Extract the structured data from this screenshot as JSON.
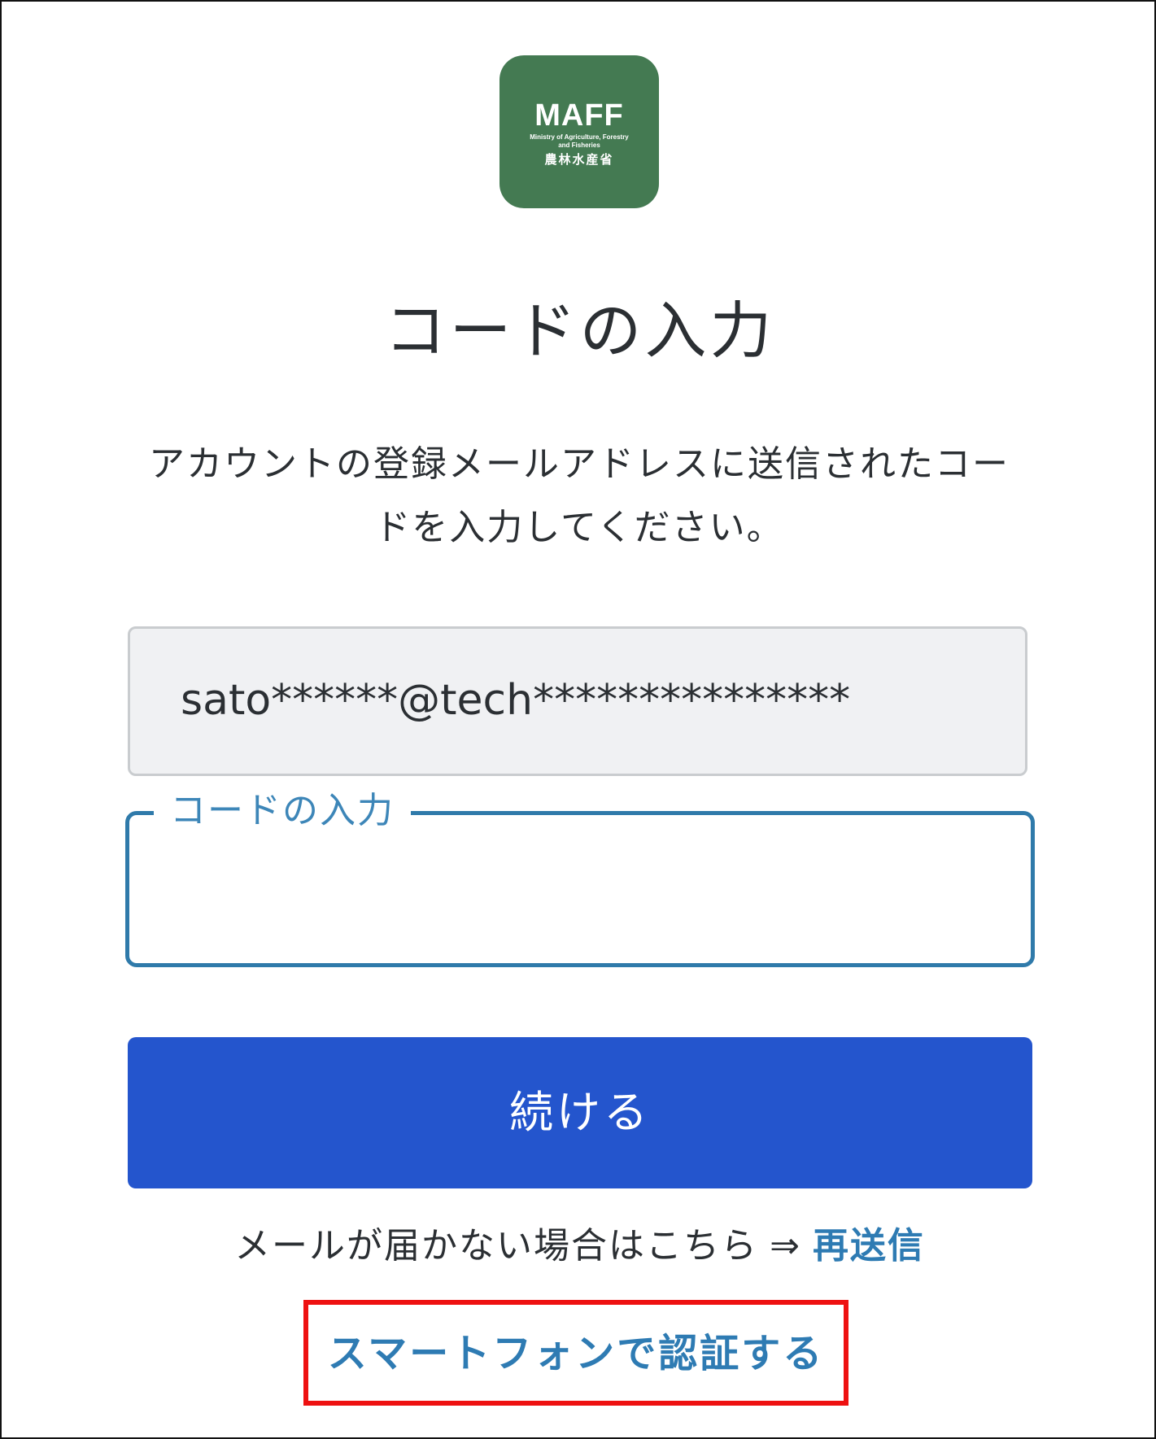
{
  "logo": {
    "abbr": "MAFF",
    "english": "Ministry of Agriculture, Forestry and Fisheries",
    "japanese": "農林水産省"
  },
  "page_title": "コードの入力",
  "description": "アカウントの登録メールアドレスに送信されたコードを入力してください。",
  "email_field": {
    "value": "sato******@tech***************"
  },
  "code_field": {
    "label": "コードの入力",
    "value": ""
  },
  "continue_button": {
    "label": "続ける"
  },
  "resend": {
    "text": "メールが届かない場合はこちら",
    "arrow": "⇒",
    "link_label": "再送信"
  },
  "smartphone_auth_link": {
    "label": "スマートフォンで認証する"
  },
  "colors": {
    "logo_bg": "#447a52",
    "primary_button": "#2455cd",
    "link": "#2e7bb3",
    "focus_border": "#2f7aaa",
    "highlight_border": "#ee1111"
  }
}
